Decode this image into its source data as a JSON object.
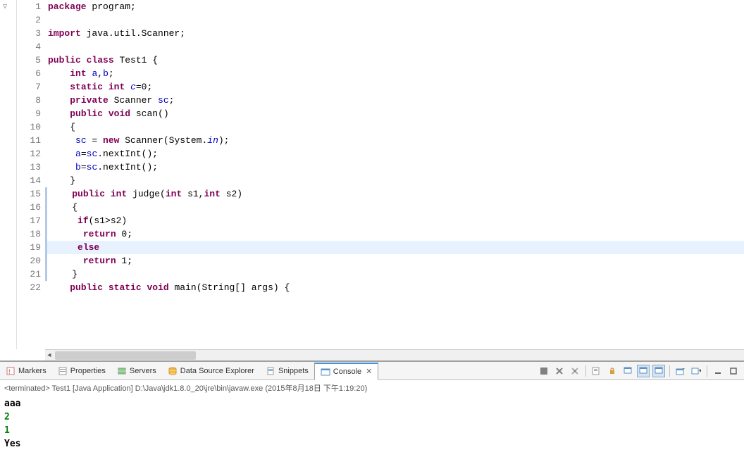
{
  "editor": {
    "lines": [
      {
        "n": 1,
        "tokens": [
          {
            "t": "package",
            "c": "kw"
          },
          {
            "t": " program;"
          }
        ]
      },
      {
        "n": 2,
        "tokens": []
      },
      {
        "n": 3,
        "tokens": [
          {
            "t": "import",
            "c": "kw"
          },
          {
            "t": " java.util.Scanner;"
          }
        ]
      },
      {
        "n": 4,
        "tokens": []
      },
      {
        "n": 5,
        "tokens": [
          {
            "t": "public",
            "c": "kw"
          },
          {
            "t": " "
          },
          {
            "t": "class",
            "c": "kw"
          },
          {
            "t": " Test1 {"
          }
        ]
      },
      {
        "n": 6,
        "tokens": [
          {
            "t": "    "
          },
          {
            "t": "int",
            "c": "kw"
          },
          {
            "t": " "
          },
          {
            "t": "a",
            "c": "fld"
          },
          {
            "t": ","
          },
          {
            "t": "b",
            "c": "fld"
          },
          {
            "t": ";"
          }
        ]
      },
      {
        "n": 7,
        "tokens": [
          {
            "t": "    "
          },
          {
            "t": "static",
            "c": "kw"
          },
          {
            "t": " "
          },
          {
            "t": "int",
            "c": "kw"
          },
          {
            "t": " "
          },
          {
            "t": "c",
            "c": "sfld"
          },
          {
            "t": "=0;"
          }
        ]
      },
      {
        "n": 8,
        "tokens": [
          {
            "t": "    "
          },
          {
            "t": "private",
            "c": "kw"
          },
          {
            "t": " Scanner "
          },
          {
            "t": "sc",
            "c": "fld"
          },
          {
            "t": ";"
          }
        ]
      },
      {
        "n": 9,
        "fold": true,
        "tokens": [
          {
            "t": "    "
          },
          {
            "t": "public",
            "c": "kw"
          },
          {
            "t": " "
          },
          {
            "t": "void",
            "c": "kw"
          },
          {
            "t": " scan()"
          }
        ]
      },
      {
        "n": 10,
        "tokens": [
          {
            "t": "    {"
          }
        ]
      },
      {
        "n": 11,
        "tokens": [
          {
            "t": "     "
          },
          {
            "t": "sc",
            "c": "fld"
          },
          {
            "t": " = "
          },
          {
            "t": "new",
            "c": "kw"
          },
          {
            "t": " Scanner(System."
          },
          {
            "t": "in",
            "c": "sfld"
          },
          {
            "t": ");"
          }
        ]
      },
      {
        "n": 12,
        "tokens": [
          {
            "t": "     "
          },
          {
            "t": "a",
            "c": "fld"
          },
          {
            "t": "="
          },
          {
            "t": "sc",
            "c": "fld"
          },
          {
            "t": ".nextInt();"
          }
        ]
      },
      {
        "n": 13,
        "tokens": [
          {
            "t": "     "
          },
          {
            "t": "b",
            "c": "fld"
          },
          {
            "t": "="
          },
          {
            "t": "sc",
            "c": "fld"
          },
          {
            "t": ".nextInt();"
          }
        ]
      },
      {
        "n": 14,
        "tokens": [
          {
            "t": "    }"
          }
        ]
      },
      {
        "n": 15,
        "fold": true,
        "change": true,
        "tokens": [
          {
            "t": "    "
          },
          {
            "t": "public",
            "c": "kw"
          },
          {
            "t": " "
          },
          {
            "t": "int",
            "c": "kw"
          },
          {
            "t": " judge("
          },
          {
            "t": "int",
            "c": "kw"
          },
          {
            "t": " s1,"
          },
          {
            "t": "int",
            "c": "kw"
          },
          {
            "t": " s2)"
          }
        ]
      },
      {
        "n": 16,
        "change": true,
        "tokens": [
          {
            "t": "    {"
          }
        ]
      },
      {
        "n": 17,
        "change": true,
        "tokens": [
          {
            "t": "     "
          },
          {
            "t": "if",
            "c": "kw"
          },
          {
            "t": "(s1>s2)"
          }
        ]
      },
      {
        "n": 18,
        "change": true,
        "tokens": [
          {
            "t": "      "
          },
          {
            "t": "return",
            "c": "kw"
          },
          {
            "t": " 0;"
          }
        ]
      },
      {
        "n": 19,
        "change": true,
        "highlight": true,
        "tokens": [
          {
            "t": "     "
          },
          {
            "t": "else",
            "c": "kw"
          }
        ]
      },
      {
        "n": 20,
        "change": true,
        "tokens": [
          {
            "t": "      "
          },
          {
            "t": "return",
            "c": "kw"
          },
          {
            "t": " 1;"
          }
        ]
      },
      {
        "n": 21,
        "change": true,
        "tokens": [
          {
            "t": "    }"
          }
        ]
      },
      {
        "n": 22,
        "fold": true,
        "tokens": [
          {
            "t": "    "
          },
          {
            "t": "public",
            "c": "kw"
          },
          {
            "t": " "
          },
          {
            "t": "static",
            "c": "kw"
          },
          {
            "t": " "
          },
          {
            "t": "void",
            "c": "kw"
          },
          {
            "t": " main(String[] args) {"
          }
        ]
      }
    ]
  },
  "tabs": [
    {
      "id": "markers",
      "label": "Markers",
      "icon": "markers"
    },
    {
      "id": "properties",
      "label": "Properties",
      "icon": "properties"
    },
    {
      "id": "servers",
      "label": "Servers",
      "icon": "servers"
    },
    {
      "id": "dse",
      "label": "Data Source Explorer",
      "icon": "dse"
    },
    {
      "id": "snippets",
      "label": "Snippets",
      "icon": "snippets"
    },
    {
      "id": "console",
      "label": "Console",
      "icon": "console",
      "active": true,
      "closable": true
    }
  ],
  "console": {
    "status": "<terminated> Test1 [Java Application] D:\\Java\\jdk1.8.0_20\\jre\\bin\\javaw.exe (2015年8月18日 下午1:19:20)",
    "output": [
      {
        "text": "aaa",
        "cls": "out-prog"
      },
      {
        "text": "2",
        "cls": "out-user"
      },
      {
        "text": "1",
        "cls": "out-user"
      },
      {
        "text": "Yes",
        "cls": "out-prog"
      }
    ]
  }
}
